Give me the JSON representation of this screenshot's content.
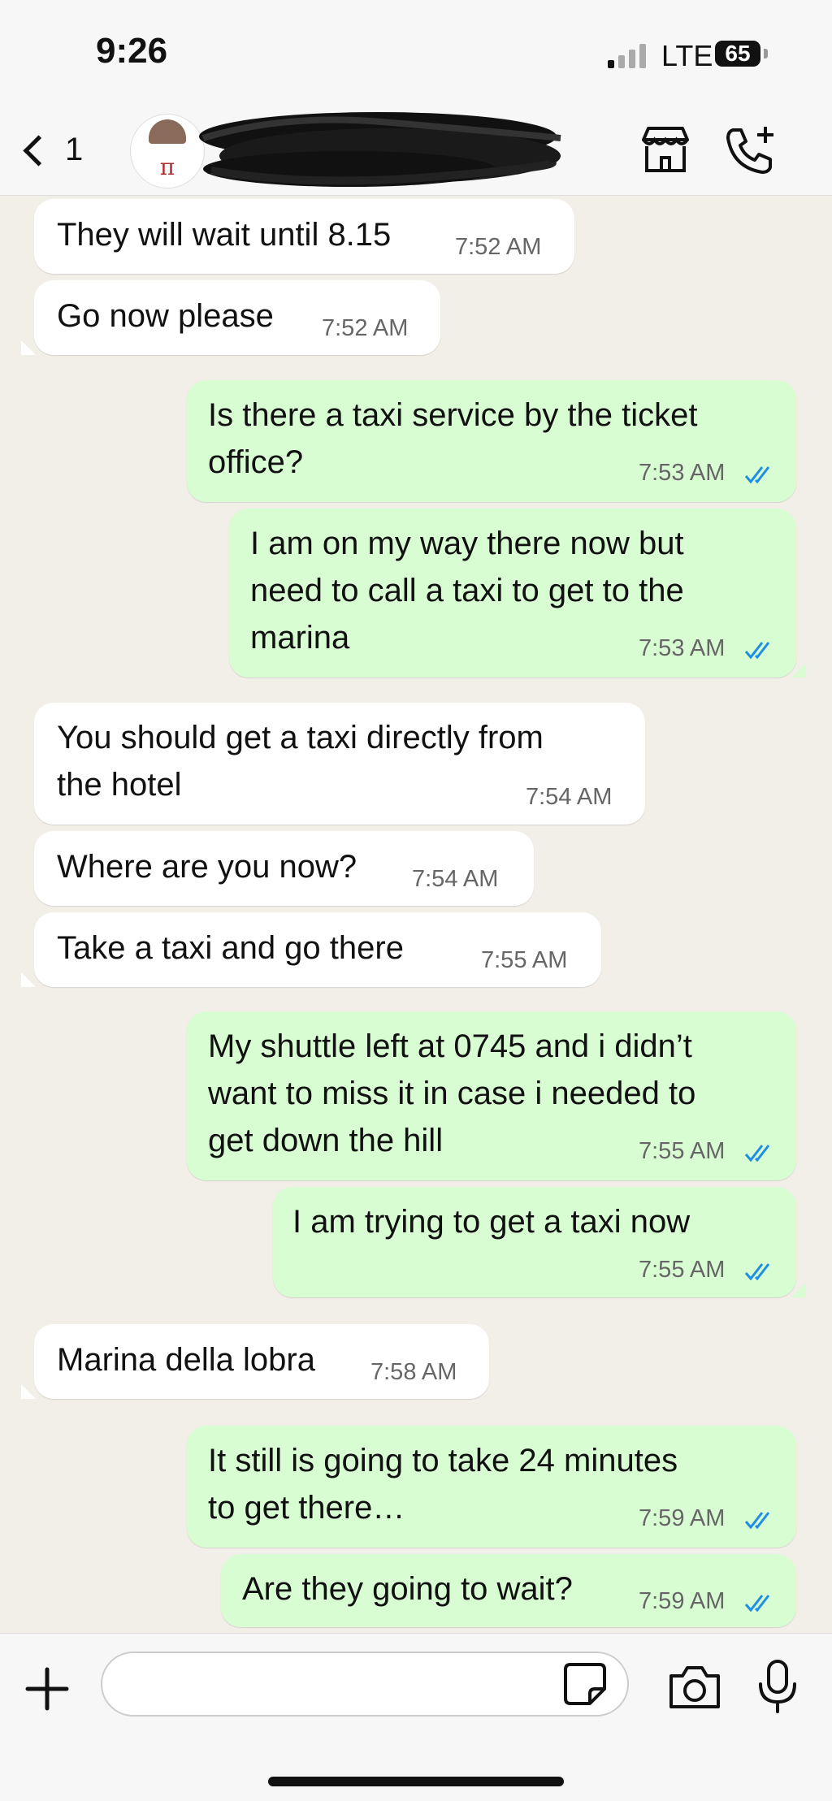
{
  "status_bar": {
    "time": "9:26",
    "network": "LTE",
    "battery": "65"
  },
  "header": {
    "back_count": "1",
    "avatar_text": "π"
  },
  "messages": [
    {
      "dir": "in",
      "text": "They will wait until 8.15",
      "time": "7:52 AM"
    },
    {
      "dir": "in",
      "text": "Go now please",
      "time": "7:52 AM"
    },
    {
      "dir": "out",
      "text": "Is there a taxi service by the ticket\noffice?",
      "time": "7:53 AM"
    },
    {
      "dir": "out",
      "text": "I am on my way there now but\nneed to call a taxi to get to the\nmarina",
      "time": "7:53 AM"
    },
    {
      "dir": "in",
      "text": "You should get a taxi directly from\nthe hotel",
      "time": "7:54 AM"
    },
    {
      "dir": "in",
      "text": "Where are you now?",
      "time": "7:54 AM"
    },
    {
      "dir": "in",
      "text": "Take a taxi and go there",
      "time": "7:55 AM"
    },
    {
      "dir": "out",
      "text": "My shuttle left at 0745 and i didn’t\nwant to miss it in case i needed to\nget down the hill",
      "time": "7:55 AM"
    },
    {
      "dir": "out",
      "text": "I am trying to get a taxi now",
      "time": "7:55 AM"
    },
    {
      "dir": "in",
      "text": "Marina della lobra",
      "time": "7:58 AM"
    },
    {
      "dir": "out",
      "text": "It still is going to take 24 minutes\nto get there…",
      "time": "7:59 AM"
    },
    {
      "dir": "out",
      "text": "Are they going to wait?",
      "time": "7:59 AM"
    }
  ],
  "composer": {
    "placeholder": ""
  },
  "colors": {
    "incoming": "#ffffff",
    "outgoing": "#d9fdd3",
    "read_ticks": "#1f8fe5",
    "background": "#f2efe9"
  }
}
